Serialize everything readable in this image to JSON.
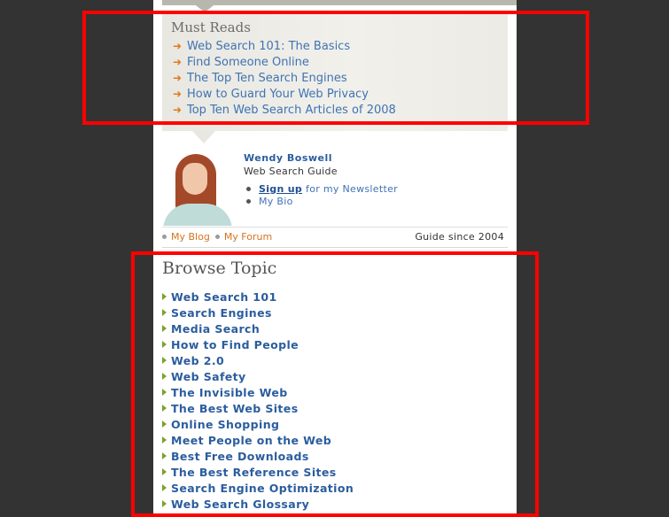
{
  "must_reads": {
    "title": "Must Reads",
    "items": [
      "Web Search 101: The Basics",
      "Find Someone Online",
      "The Top Ten Search Engines",
      "How to Guard Your Web Privacy",
      "Top Ten Web Search Articles of 2008"
    ]
  },
  "guide": {
    "name": "Wendy Boswell",
    "role": "Web Search Guide",
    "signup": "Sign up",
    "signup_rest": "for my Newsletter",
    "bio": "My Bio",
    "blog": "My Blog",
    "forum": "My Forum",
    "since": "Guide since 2004"
  },
  "browse": {
    "title": "Browse Topic",
    "topics": [
      "Web Search 101",
      "Search Engines",
      "Media Search",
      "How to Find People",
      "Web 2.0",
      "Web Safety",
      "The Invisible Web",
      "The Best Web Sites",
      "Online Shopping",
      "Meet People on the Web",
      "Best Free Downloads",
      "The Best Reference Sites",
      "Search Engine Optimization",
      "Web Search Glossary"
    ]
  },
  "colors": {
    "background": "#333333",
    "link_blue": "#3f73b3",
    "topic_blue": "#2b5d9e",
    "orange": "#d8731e",
    "arrow_orange": "#e07a1f",
    "topic_triangle": "#7aa32b",
    "highlight_red": "#ff0000"
  },
  "icons": {
    "must_read_arrow": "arrow-right-icon",
    "topic_marker": "triangle-right-icon",
    "guide_photo": "avatar"
  }
}
